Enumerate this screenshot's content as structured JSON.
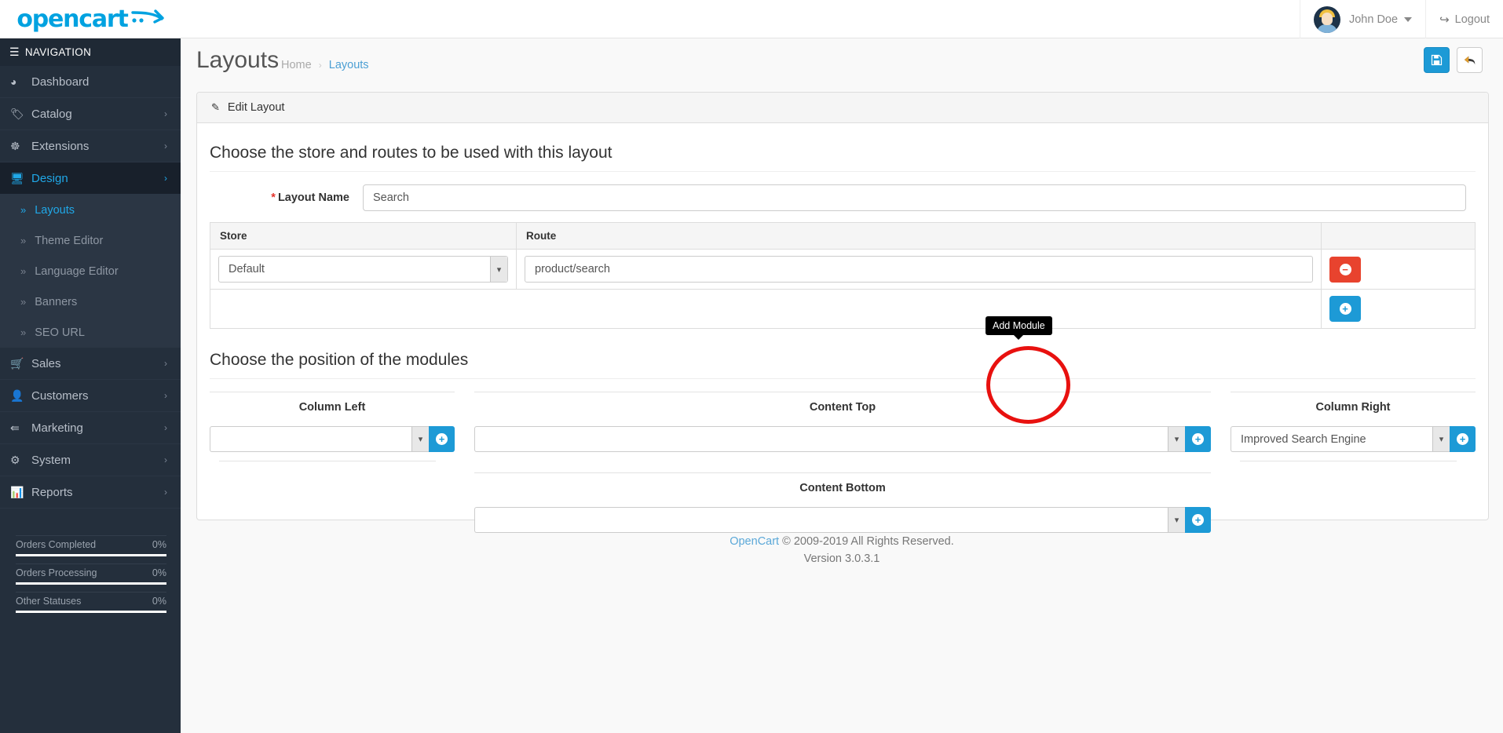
{
  "brand": {
    "name": "opencart",
    "accent": "#00a2e0"
  },
  "header": {
    "user_name": "John Doe",
    "logout_label": "Logout"
  },
  "sidebar": {
    "nav_header": "NAVIGATION",
    "items": [
      {
        "label": "Dashboard",
        "icon": "dashboard-icon",
        "has_chevron": false,
        "active": false
      },
      {
        "label": "Catalog",
        "icon": "tag-icon",
        "has_chevron": true,
        "active": false
      },
      {
        "label": "Extensions",
        "icon": "puzzle-icon",
        "has_chevron": true,
        "active": false
      },
      {
        "label": "Design",
        "icon": "monitor-icon",
        "has_chevron": true,
        "active": true
      }
    ],
    "sub_items": [
      {
        "label": "Layouts",
        "active": true
      },
      {
        "label": "Theme Editor",
        "active": false
      },
      {
        "label": "Language Editor",
        "active": false
      },
      {
        "label": "Banners",
        "active": false
      },
      {
        "label": "SEO URL",
        "active": false
      }
    ],
    "items_lower": [
      {
        "label": "Sales",
        "icon": "cart-icon",
        "has_chevron": true
      },
      {
        "label": "Customers",
        "icon": "user-icon",
        "has_chevron": true
      },
      {
        "label": "Marketing",
        "icon": "share-icon",
        "has_chevron": true
      },
      {
        "label": "System",
        "icon": "gear-icon",
        "has_chevron": true
      },
      {
        "label": "Reports",
        "icon": "bar-chart-icon",
        "has_chevron": true
      }
    ],
    "stats": [
      {
        "label": "Orders Completed",
        "value": "0%",
        "percent": 100
      },
      {
        "label": "Orders Processing",
        "value": "0%",
        "percent": 100
      },
      {
        "label": "Other Statuses",
        "value": "0%",
        "percent": 100
      }
    ]
  },
  "page": {
    "title": "Layouts",
    "breadcrumb_home": "Home",
    "breadcrumb_sep": "›",
    "breadcrumb_current": "Layouts",
    "save_icon": "save-icon",
    "back_icon": "back-arrow-icon"
  },
  "panel": {
    "heading": "Edit Layout",
    "section_routes": "Choose the store and routes to be used with this layout",
    "section_modules": "Choose the position of the modules",
    "layout_name_label": "Layout Name",
    "layout_name_required": "*",
    "layout_name_value": "Search",
    "table": {
      "columns": [
        "Store",
        "Route",
        ""
      ],
      "rows": [
        {
          "store": "Default",
          "route": "product/search",
          "remove_icon": "minus-circle-icon"
        }
      ],
      "add_icon": "plus-circle-icon"
    },
    "modules": [
      {
        "title": "Column Left",
        "value": "",
        "add_icon": "plus-circle-icon"
      },
      {
        "title": "Content Top",
        "value": "",
        "add_icon": "plus-circle-icon"
      },
      {
        "title": "Column Right",
        "value": "Improved Search Engine",
        "add_icon": "plus-circle-icon"
      },
      {
        "title": "Content Bottom",
        "value": "",
        "add_icon": "plus-circle-icon"
      }
    ]
  },
  "annotation": {
    "tooltip_text": "Add Module",
    "circle_color": "#e8110f"
  },
  "footer": {
    "link": "OpenCart",
    "copyright": " © 2009-2019 All Rights Reserved.",
    "version": "Version 3.0.3.1"
  }
}
